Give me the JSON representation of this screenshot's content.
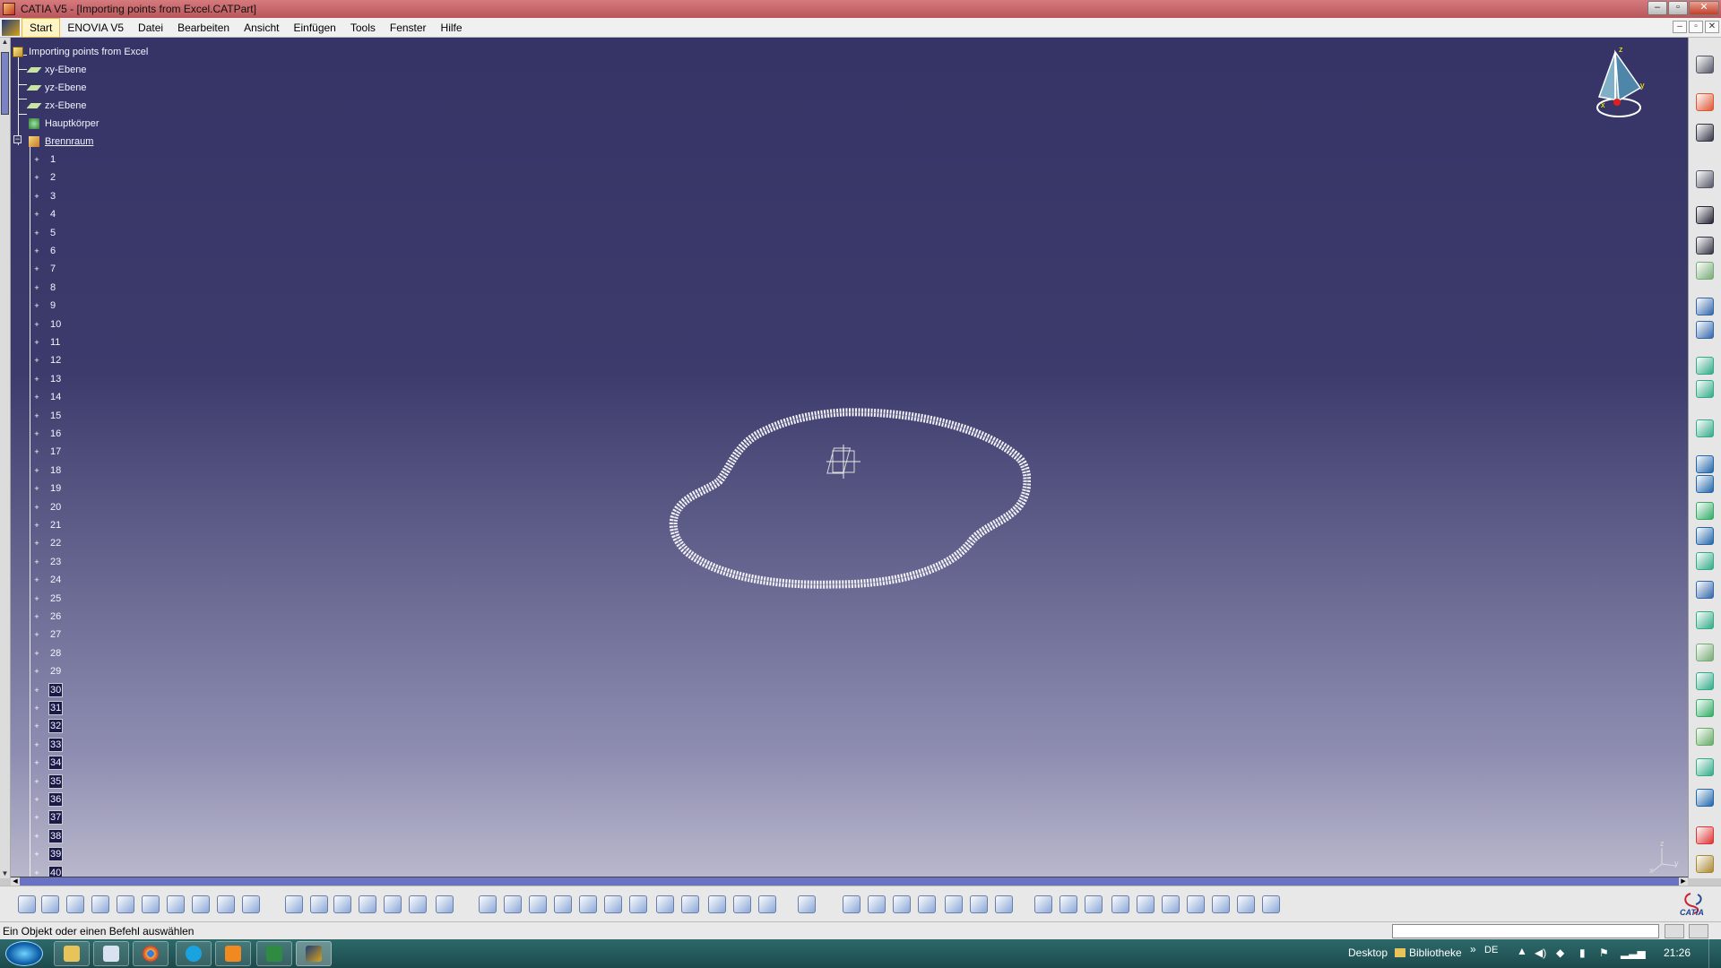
{
  "window": {
    "title": "CATIA V5 - [Importing points from Excel.CATPart]"
  },
  "menu": {
    "items": [
      "Start",
      "ENOVIA V5",
      "Datei",
      "Bearbeiten",
      "Ansicht",
      "Einfügen",
      "Tools",
      "Fenster",
      "Hilfe"
    ]
  },
  "tree": {
    "root": "Importing points from Excel",
    "planes": [
      "xy-Ebene",
      "yz-Ebene",
      "zx-Ebene"
    ],
    "body": "Hauptkörper",
    "geoset": "Brennraum",
    "points": [
      "1",
      "2",
      "3",
      "4",
      "5",
      "6",
      "7",
      "8",
      "9",
      "10",
      "11",
      "12",
      "13",
      "14",
      "15",
      "16",
      "17",
      "18",
      "19",
      "20",
      "21",
      "22",
      "23",
      "24",
      "25",
      "26",
      "27",
      "28",
      "29",
      "30",
      "31",
      "32",
      "33",
      "34",
      "35",
      "36",
      "37",
      "38",
      "39",
      "40"
    ]
  },
  "compass": {
    "z": "z",
    "y": "y",
    "x": "x"
  },
  "axis_indicator": {
    "z": "z",
    "y": "y",
    "x": "x"
  },
  "status": {
    "message": "Ein Objekt oder einen Befehl auswählen",
    "command_value": ""
  },
  "taskbar": {
    "desktop": "Desktop",
    "library": "Bibliotheke",
    "lang": "DE",
    "time": "21:26"
  },
  "colors": {
    "viewport_top": "#363466",
    "viewport_bottom": "#b9b8cc",
    "title_bar": "#c0575c",
    "highlight": "#fff4c4"
  },
  "catia_brand": "CATIA"
}
